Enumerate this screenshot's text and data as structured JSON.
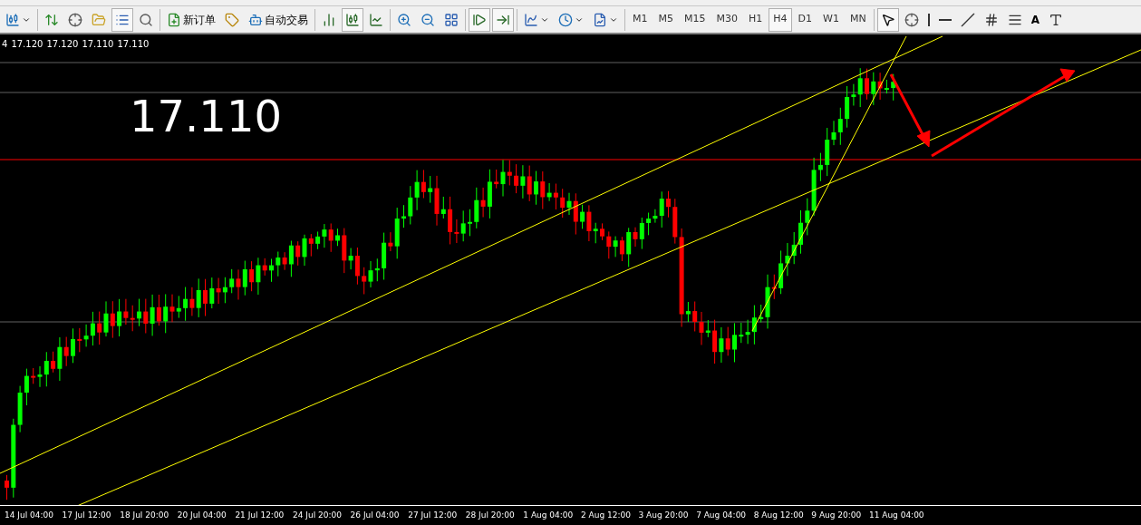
{
  "toolbar": {
    "groups": [
      [
        {
          "kind": "chart",
          "pressed": false,
          "dropdown": true
        }
      ],
      [
        {
          "kind": "arrows",
          "pressed": false
        },
        {
          "kind": "crosshair",
          "pressed": false
        },
        {
          "kind": "favorites",
          "pressed": false
        },
        {
          "kind": "list",
          "pressed": true
        },
        {
          "kind": "magnifier",
          "pressed": false
        }
      ],
      [
        {
          "kind": "order",
          "pressed": false,
          "label": "新订单"
        },
        {
          "kind": "eraser",
          "pressed": false
        },
        {
          "kind": "robot",
          "pressed": false,
          "label": "自动交易"
        }
      ],
      [
        {
          "kind": "bars",
          "pressed": false
        },
        {
          "kind": "candles",
          "pressed": true
        },
        {
          "kind": "line",
          "pressed": false
        }
      ],
      [
        {
          "kind": "zoomin",
          "pressed": false
        },
        {
          "kind": "zoomout",
          "pressed": false
        },
        {
          "kind": "tile",
          "pressed": false
        }
      ],
      [
        {
          "kind": "scroll",
          "pressed": true
        },
        {
          "kind": "shift",
          "pressed": true
        }
      ],
      [
        {
          "kind": "indicator",
          "pressed": false,
          "dropdown": true
        },
        {
          "kind": "clock",
          "pressed": false,
          "dropdown": true
        },
        {
          "kind": "template",
          "pressed": false,
          "dropdown": true
        }
      ]
    ],
    "timeframes": [
      {
        "label": "M1",
        "selected": false
      },
      {
        "label": "M5",
        "selected": false
      },
      {
        "label": "M15",
        "selected": false
      },
      {
        "label": "M30",
        "selected": false
      },
      {
        "label": "H1",
        "selected": false
      },
      {
        "label": "H4",
        "selected": true
      },
      {
        "label": "D1",
        "selected": false
      },
      {
        "label": "W1",
        "selected": false
      },
      {
        "label": "MN",
        "selected": false
      }
    ],
    "tools": [
      {
        "kind": "cursor",
        "pressed": true
      },
      {
        "kind": "crosshair",
        "pressed": false
      },
      {
        "kind": "vline",
        "pressed": false
      },
      {
        "kind": "hline",
        "pressed": false
      },
      {
        "kind": "trend",
        "pressed": false
      },
      {
        "kind": "channel",
        "pressed": false
      },
      {
        "kind": "fibo",
        "pressed": false
      },
      {
        "kind": "text",
        "pressed": false,
        "label": "A"
      },
      {
        "kind": "label",
        "pressed": false
      }
    ]
  },
  "chart": {
    "ohlc": [
      "4",
      "17.120",
      "17.120",
      "17.110",
      "17.110"
    ],
    "price": "17.110",
    "time_labels": [
      "14 Jul 04:00",
      "17 Jul 12:00",
      "18 Jul 20:00",
      "20 Jul 04:00",
      "21 Jul 12:00",
      "24 Jul 20:00",
      "26 Jul 04:00",
      "27 Jul 12:00",
      "28 Jul 20:00",
      "1 Aug 04:00",
      "2 Aug 12:00",
      "3 Aug 20:00",
      "7 Aug 04:00",
      "8 Aug 12:00",
      "9 Aug 20:00",
      "11 Aug 04:00"
    ]
  }
}
